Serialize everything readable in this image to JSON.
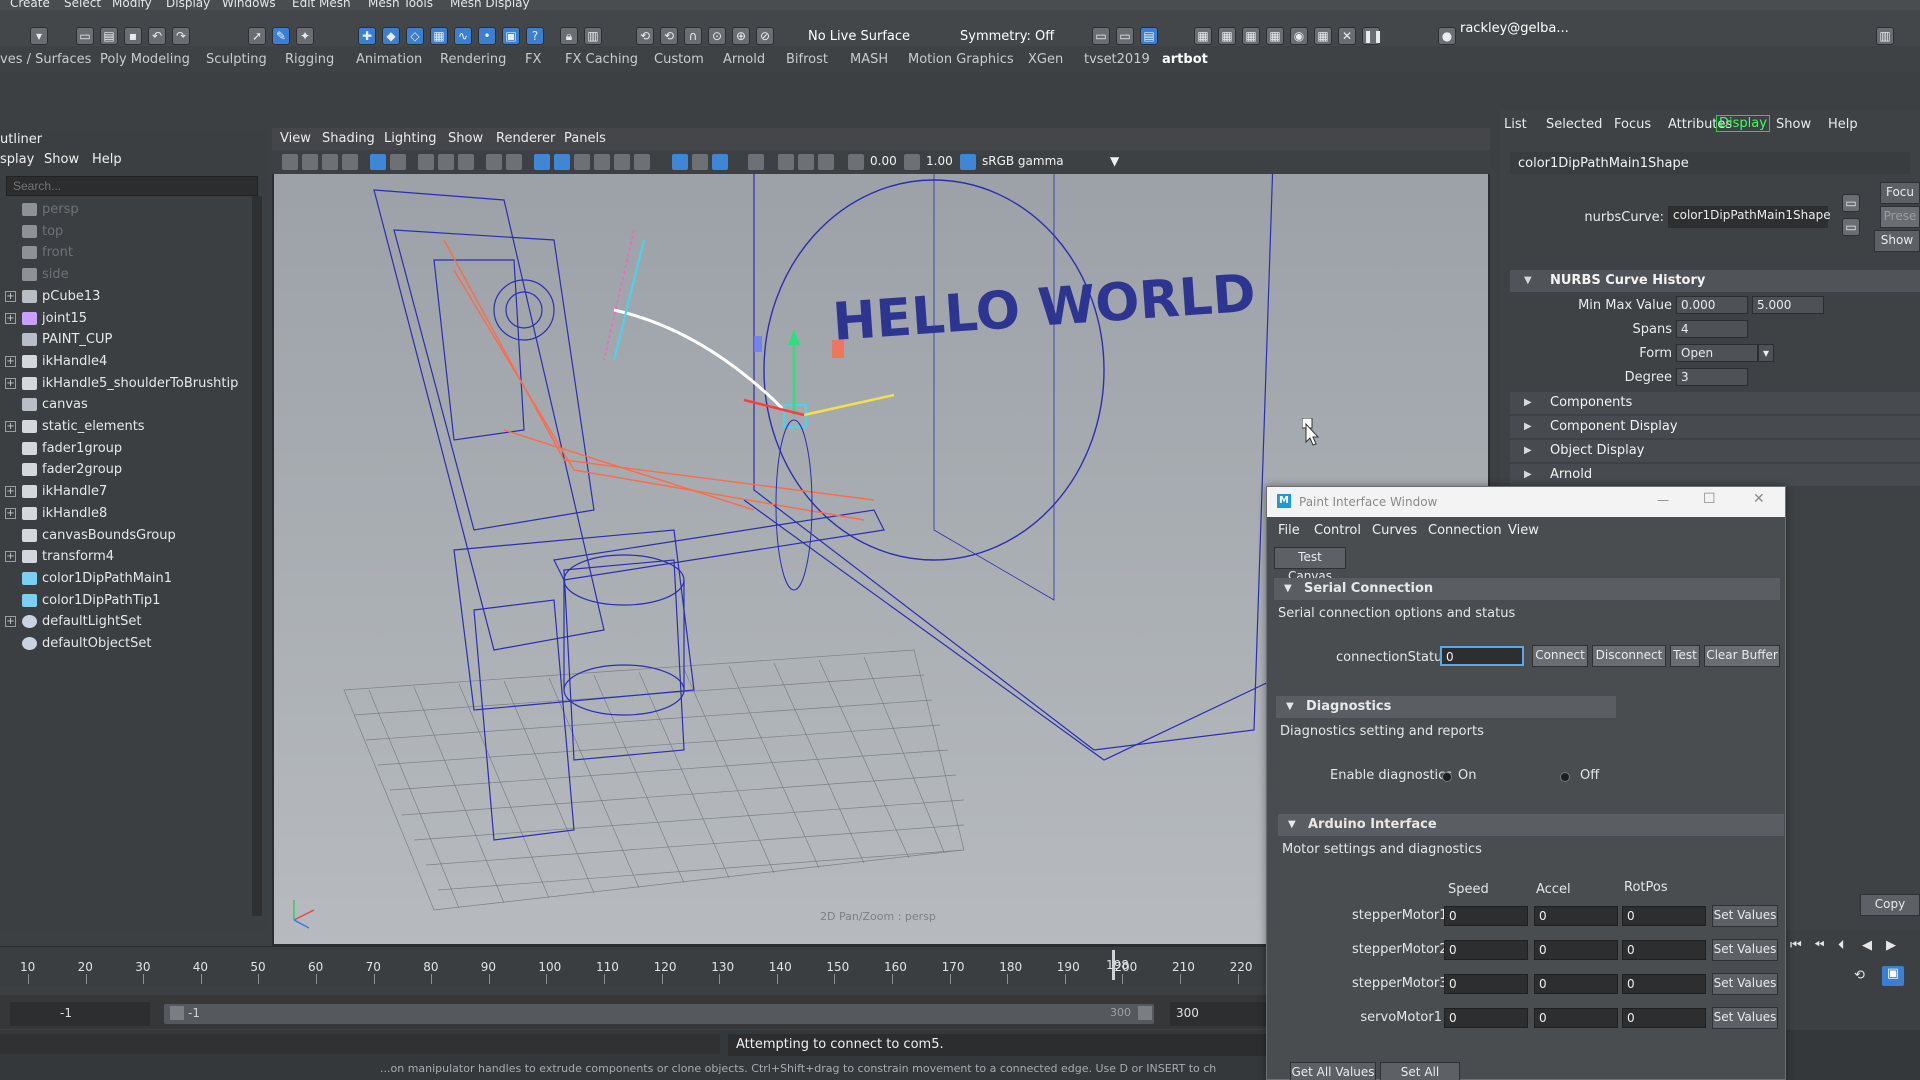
{
  "main_menu": [
    "Create",
    "Select",
    "Modify",
    "Display",
    "Windows",
    "Edit Mesh",
    "Mesh Tools",
    "Mesh Display"
  ],
  "status_line": {
    "live_surface": "No Live Surface",
    "symmetry": "Symmetry: Off",
    "account": "rackley@gelba..."
  },
  "shelf_tabs": [
    "ves / Surfaces",
    "Poly Modeling",
    "Sculpting",
    "Rigging",
    "Animation",
    "Rendering",
    "FX",
    "FX Caching",
    "Custom",
    "Arnold",
    "Bifrost",
    "MASH",
    "Motion Graphics",
    "XGen",
    "tvset2019",
    "artbot"
  ],
  "outliner": {
    "title": "utliner",
    "menu": [
      "splay",
      "Show",
      "Help"
    ],
    "search_placeholder": "Search...",
    "items": [
      {
        "label": "persp",
        "expandable": false,
        "dim": true,
        "icon": "camera-icon"
      },
      {
        "label": "top",
        "expandable": false,
        "dim": true,
        "icon": "camera-icon"
      },
      {
        "label": "front",
        "expandable": false,
        "dim": true,
        "icon": "camera-icon"
      },
      {
        "label": "side",
        "expandable": false,
        "dim": true,
        "icon": "camera-icon"
      },
      {
        "label": "pCube13",
        "expandable": true,
        "dim": false,
        "icon": "transform-icon"
      },
      {
        "label": "joint15",
        "expandable": true,
        "dim": false,
        "icon": "joint-icon"
      },
      {
        "label": "PAINT_CUP",
        "expandable": false,
        "dim": false,
        "icon": "transform-icon"
      },
      {
        "label": "ikHandle4",
        "expandable": true,
        "dim": false,
        "icon": "ik-handle-icon"
      },
      {
        "label": "ikHandle5_shoulderToBrushtip",
        "expandable": true,
        "dim": false,
        "icon": "ik-handle-icon"
      },
      {
        "label": "canvas",
        "expandable": false,
        "dim": false,
        "icon": "transform-icon"
      },
      {
        "label": "static_elements",
        "expandable": true,
        "dim": false,
        "icon": "group-icon"
      },
      {
        "label": "fader1group",
        "expandable": false,
        "dim": false,
        "icon": "group-icon"
      },
      {
        "label": "fader2group",
        "expandable": false,
        "dim": false,
        "icon": "group-icon"
      },
      {
        "label": "ikHandle7",
        "expandable": true,
        "dim": false,
        "icon": "ik-handle-icon"
      },
      {
        "label": "ikHandle8",
        "expandable": true,
        "dim": false,
        "icon": "ik-handle-icon"
      },
      {
        "label": "canvasBoundsGroup",
        "expandable": false,
        "dim": false,
        "icon": "group-icon"
      },
      {
        "label": "transform4",
        "expandable": true,
        "dim": false,
        "icon": "group-icon"
      },
      {
        "label": "color1DipPathMain1",
        "expandable": false,
        "dim": false,
        "icon": "curve-icon"
      },
      {
        "label": "color1DipPathTip1",
        "expandable": false,
        "dim": false,
        "icon": "curve-icon"
      },
      {
        "label": "defaultLightSet",
        "expandable": true,
        "dim": false,
        "icon": "set-icon"
      },
      {
        "label": "defaultObjectSet",
        "expandable": false,
        "dim": false,
        "icon": "set-icon"
      }
    ]
  },
  "viewport": {
    "menu": [
      "View",
      "Shading",
      "Lighting",
      "Show",
      "Renderer",
      "Panels"
    ],
    "exposure": "0.00",
    "gamma": "1.00",
    "color_space": "sRGB gamma",
    "camera_label": "2D Pan/Zoom : persp",
    "canvas_text": "HELLO WORLD"
  },
  "attribute_editor": {
    "tabs": [
      "List",
      "Selected",
      "Focus",
      "Attributes",
      "Display",
      "Show",
      "Help"
    ],
    "highlight_tab": "Display",
    "node_name": "color1DipPathMain1Shape",
    "nurbs_curve_label": "nurbsCurve:",
    "nurbs_curve_value": "color1DipPathMain1Shape",
    "focus_button": "Focu",
    "presets_button": "Prese",
    "show_button": "Show",
    "history_section": "NURBS Curve History",
    "min_max_label": "Min Max Value",
    "min_value": "0.000",
    "max_value": "5.000",
    "spans_label": "Spans",
    "spans_value": "4",
    "form_label": "Form",
    "form_value": "Open",
    "degree_label": "Degree",
    "degree_value": "3",
    "sections": [
      "Components",
      "Component Display",
      "Object Display",
      "Arnold"
    ],
    "copy_button": "Copy"
  },
  "timeline": {
    "ticks": [
      "10",
      "20",
      "30",
      "40",
      "50",
      "60",
      "70",
      "80",
      "90",
      "100",
      "110",
      "120",
      "130",
      "140",
      "150",
      "160",
      "170",
      "180",
      "190",
      "200",
      "210",
      "220"
    ],
    "current_frame": "198",
    "start_frame": "-1",
    "range_start": "-1",
    "range_end": "300",
    "anim_end": "300"
  },
  "status_message": "Attempting to connect to com5.",
  "help_line": "...on manipulator handles to extrude components or clone objects. Ctrl+Shift+drag to constrain movement to a connected edge. Use D or INSERT to ch",
  "paint_window": {
    "title": "Paint Interface Window",
    "menu": [
      "File",
      "Control",
      "Curves",
      "Connection",
      "View"
    ],
    "test_canvas": "Test Canvas",
    "serial": {
      "header": "Serial Connection",
      "desc": "Serial connection options and status",
      "status_label": "connectionStatus",
      "status_value": "0",
      "buttons": [
        "Connect",
        "Disconnect",
        "Test",
        "Clear Buffer"
      ]
    },
    "diagnostics": {
      "header": "Diagnostics",
      "desc": "Diagnostics setting and reports",
      "enable_label": "Enable diagnostics",
      "on_label": "On",
      "off_label": "Off"
    },
    "arduino": {
      "header": "Arduino Interface",
      "desc": "Motor settings and diagnostics",
      "columns": [
        "Speed",
        "Accel",
        "RotPos"
      ],
      "rows": [
        {
          "label": "stepperMotor1",
          "speed": "0",
          "accel": "0",
          "rotpos": "0",
          "button": "Set Values"
        },
        {
          "label": "stepperMotor2",
          "speed": "0",
          "accel": "0",
          "rotpos": "0",
          "button": "Set Values"
        },
        {
          "label": "stepperMotor3",
          "speed": "0",
          "accel": "0",
          "rotpos": "0",
          "button": "Set Values"
        },
        {
          "label": "servoMotor1",
          "speed": "0",
          "accel": "0",
          "rotpos": "0",
          "button": "Set Values"
        }
      ],
      "get_all": "Get All Values",
      "set_all": "Set All Values"
    }
  },
  "colors": {
    "wireframe": "#2a2fb0",
    "selection_highlight": "#ff6a4a",
    "accent_blue": "#3e86d6",
    "display_tab": "#3bff5a"
  }
}
